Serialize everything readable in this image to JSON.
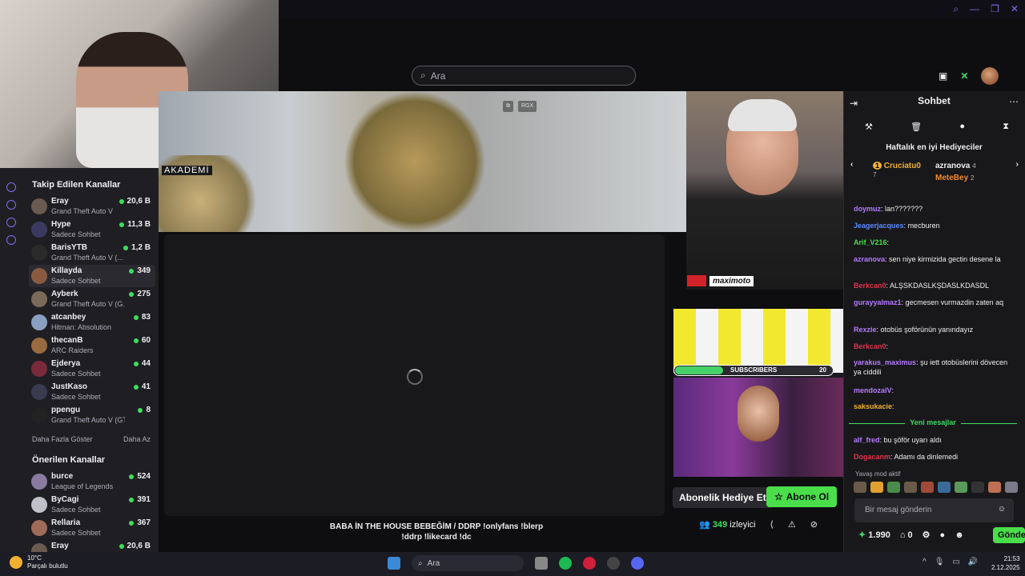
{
  "search": {
    "placeholder": "Ara"
  },
  "webcam": {
    "overlay_text": "AKADEMİ"
  },
  "player_overlay": {
    "btn_rgx": "RGX"
  },
  "sidebar": {
    "followed_title": "Takip Edilen Kanallar",
    "followed": [
      {
        "name": "Eray",
        "game": "Grand Theft Auto V",
        "viewers": "20,6 B"
      },
      {
        "name": "Hype",
        "game": "Sadece Sohbet",
        "viewers": "11,3 B"
      },
      {
        "name": "BarisYTB",
        "game": "Grand Theft Auto V (...",
        "viewers": "1,2 B"
      },
      {
        "name": "Killayda",
        "game": "Sadece Sohbet",
        "viewers": "349"
      },
      {
        "name": "Ayberk",
        "game": "Grand Theft Auto V (G...",
        "viewers": "275"
      },
      {
        "name": "atcanbey",
        "game": "Hitman: Absolution",
        "viewers": "83"
      },
      {
        "name": "thecanB",
        "game": "ARC Raiders",
        "viewers": "60"
      },
      {
        "name": "Ejderya",
        "game": "Sadece Sohbet",
        "viewers": "44"
      },
      {
        "name": "JustKaso",
        "game": "Sadece Sohbet",
        "viewers": "41"
      },
      {
        "name": "ppengu",
        "game": "Grand Theft Auto V (GTA)",
        "viewers": "8"
      }
    ],
    "show_more": "Daha Fazla Göster",
    "show_less": "Daha Az",
    "recommended_title": "Önerilen Kanallar",
    "recommended": [
      {
        "name": "burce",
        "game": "League of Legends",
        "viewers": "524"
      },
      {
        "name": "ByCagi",
        "game": "Sadece Sohbet",
        "viewers": "391"
      },
      {
        "name": "Rellaria",
        "game": "Sadece Sohbet",
        "viewers": "367"
      },
      {
        "name": "Eray",
        "game": "",
        "viewers": "20,6 B"
      }
    ]
  },
  "stream": {
    "title_line1": "BABA İN THE HOUSE BEBEĞİM / DDRP !onlyfans !blerp",
    "title_line2": "!ddrp !likecard !dc",
    "viewer_count": "349",
    "viewer_label": "izleyici",
    "gift_button": "Abonelik Hediye Et",
    "subscribe_button": "Abone Ol"
  },
  "overlays": {
    "sponsor_logo": "maximoto",
    "subs_label": "SUBSCRIBERS",
    "subs_goal": "20"
  },
  "chat": {
    "title": "Sohbet",
    "gifters_title": "Haftalık en iyi Hediyeciler",
    "gifters": [
      {
        "rank": "1",
        "name": "Cruciatu0",
        "count": "7"
      },
      {
        "name": "azranova",
        "count": "4"
      },
      {
        "name": "MeteBey",
        "count": "2"
      }
    ],
    "messages": [
      {
        "user": "doymuz",
        "text": "lan???????",
        "color": "#b57bff"
      },
      {
        "user": "Jeagerjacques",
        "text": "mecburen",
        "color": "#5b8cff"
      },
      {
        "user": "Arif_V216",
        "text": "",
        "color": "#4ade4a"
      },
      {
        "user": "azranova",
        "text": "sen niye kirmizida gectin desene la",
        "color": "#b57bff"
      },
      {
        "user": "Berkcan0",
        "text": "ALŞSKDASLKŞDASLKDASDL",
        "color": "#e0334a"
      },
      {
        "user": "gurayyalmaz1",
        "text": "gecmesen vurmazdin zaten aq",
        "color": "#b57bff"
      },
      {
        "user": "Rexzie",
        "text": "otobüs şoförünün yanındayız",
        "color": "#b57bff"
      },
      {
        "user": "Berkcan0",
        "text": "",
        "color": "#e0334a"
      },
      {
        "user": "yarakus_maximus",
        "text": "şu iett otobüslerini dövecen ya ciddili",
        "color": "#b57bff"
      },
      {
        "user": "mendozalV",
        "text": "",
        "color": "#b57bff"
      },
      {
        "user": "saksukacie",
        "text": "",
        "color": "#f0b030"
      },
      {
        "user": "alf_fred",
        "text": "bu şöför uyarı aldı",
        "color": "#b57bff"
      },
      {
        "user": "Dogacanm",
        "text": "Adamı da dinlemedi",
        "color": "#e0334a"
      }
    ],
    "new_messages": "Yeni mesajlar",
    "slow_mode": "Yavaş mod aktif",
    "input_placeholder": "Bir mesaj gönderin",
    "points": "1.990",
    "chest_count": "0",
    "send_button": "Gönder"
  },
  "taskbar": {
    "temperature": "10°C",
    "weather": "Parçalı bulutlu",
    "search": "Ara",
    "time": "21:53",
    "date": "2.12.2025"
  }
}
